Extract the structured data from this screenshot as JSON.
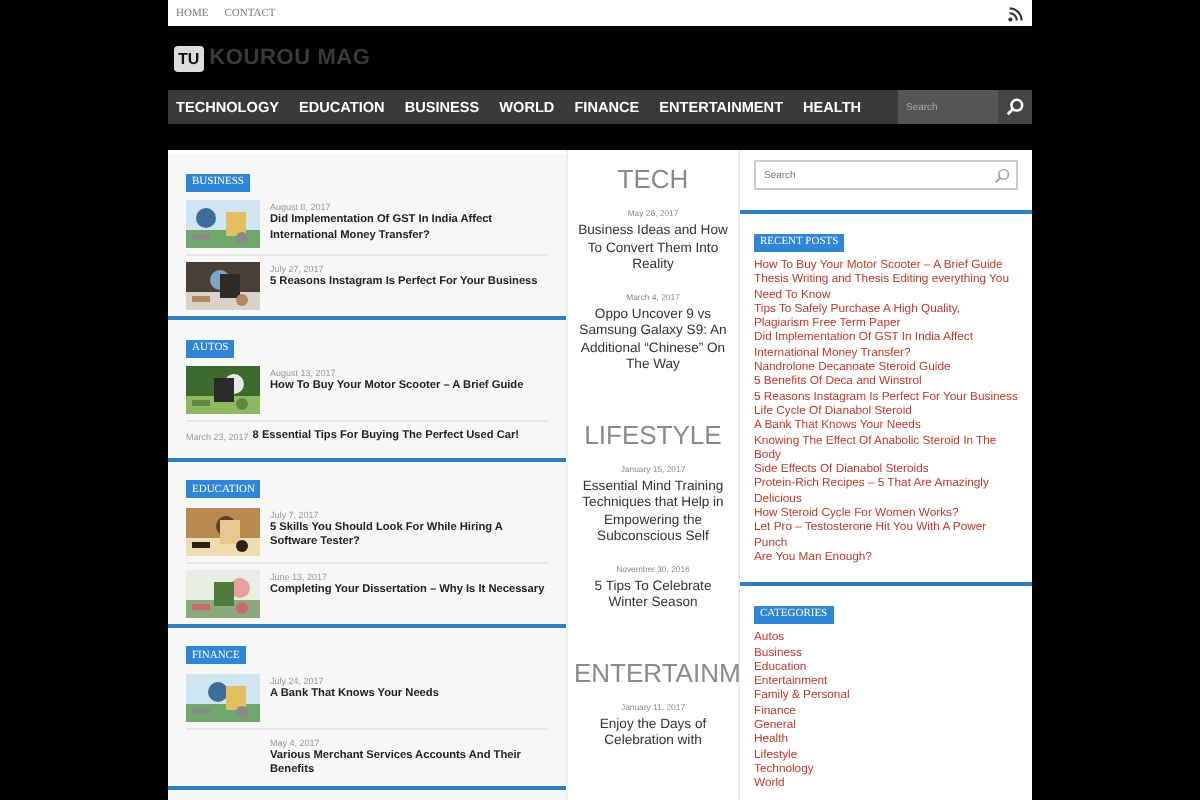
{
  "top_bar": {
    "links": [
      "HOME",
      "CONTACT"
    ]
  },
  "logo": {
    "badge": "TU",
    "name": "KOUROU MAG"
  },
  "nav": {
    "items": [
      "TECHNOLOGY",
      "EDUCATION",
      "BUSINESS",
      "WORLD",
      "FINANCE",
      "ENTERTAINMENT",
      "HEALTH"
    ],
    "search": {
      "placeholder": "Search"
    }
  },
  "left_sections": [
    {
      "label": "BUSINESS",
      "posts": [
        {
          "kind": "standard",
          "has_thumbnail": true,
          "date": "August 8, 2017",
          "title": "Did Implementation Of GST In India Affect International Money Transfer?"
        },
        {
          "kind": "standard",
          "has_thumbnail": true,
          "date": "July 27, 2017",
          "title": "5 Reasons Instagram Is Perfect For Your Business"
        }
      ]
    },
    {
      "label": "AUTOS",
      "posts": [
        {
          "kind": "standard",
          "has_thumbnail": true,
          "date": "August 13, 2017",
          "title": "How To Buy Your Motor Scooter – A Brief Guide"
        },
        {
          "kind": "inline",
          "has_thumbnail": false,
          "date": "March 23, 2017",
          "title": "8 Essential Tips For Buying The Perfect Used Car!"
        }
      ]
    },
    {
      "label": "EDUCATION",
      "posts": [
        {
          "kind": "standard",
          "has_thumbnail": true,
          "date": "July 7, 2017",
          "title": "5 Skills You Should Look For While Hiring A Software Tester?"
        },
        {
          "kind": "standard",
          "has_thumbnail": true,
          "date": "June 13, 2017",
          "title": "Completing Your Dissertation – Why Is It Necessary"
        }
      ]
    },
    {
      "label": "FINANCE",
      "posts": [
        {
          "kind": "standard",
          "has_thumbnail": true,
          "date": "July 24, 2017",
          "title": "A Bank That Knows Your Needs"
        },
        {
          "kind": "standard",
          "has_thumbnail": false,
          "date": "May 4, 2017",
          "title": "Various Merchant Services Accounts And Their Benefits"
        }
      ]
    }
  ],
  "middle_sections": [
    {
      "heading": "TECH",
      "posts": [
        {
          "date": "May 26, 2017",
          "title": "Business Ideas and How To Convert Them Into Reality"
        },
        {
          "date": "March 4, 2017",
          "title": "Oppo Uncover 9 vs Samsung Galaxy S9: An Additional “Chinese” On The Way"
        }
      ]
    },
    {
      "heading": "LIFESTYLE",
      "posts": [
        {
          "date": "January 15, 2017",
          "title": "Essential Mind Training Techniques that Help in Empowering the Subconscious Self"
        },
        {
          "date": "November 30, 2016",
          "title": "5 Tips To Celebrate Winter Season"
        }
      ]
    },
    {
      "heading": "ENTERTAINM",
      "posts": [
        {
          "date": "January 11, 2017",
          "title": "Enjoy the Days of Celebration with"
        }
      ]
    }
  ],
  "sidebar": {
    "search": {
      "placeholder": "Search"
    },
    "widgets": [
      {
        "label": "RECENT POSTS",
        "links": [
          "How To Buy Your Motor Scooter – A Brief Guide",
          "Thesis Writing and Thesis Editing everything You Need To Know",
          "Tips To Safely Purchase A High Quality, Plagiarism Free Term Paper",
          "Did Implementation Of GST In India Affect International Money Transfer?",
          "Nandrolone Decanoate Steroid Guide",
          "5 Benefits Of Deca and Winstrol",
          "5 Reasons Instagram Is Perfect For Your Business",
          "Life Cycle Of Dianabol Steroid",
          "A Bank That Knows Your Needs",
          "Knowing The Effect Of Anabolic Steroid In The Body",
          "Side Effects Of Dianabol Steroids",
          "Protein-Rich Recipes – 5 That Are Amazingly Delicious",
          "How Steroid Cycle For Women Works?",
          "Let Pro – Testosterone Hit You With A Power Punch",
          "Are You Man Enough?"
        ]
      },
      {
        "label": "CATEGORIES",
        "links": [
          "Autos",
          "Business",
          "Education",
          "Entertainment",
          "Family & Personal",
          "Finance",
          "General",
          "Health",
          "Lifestyle",
          "Technology",
          "World"
        ]
      }
    ]
  }
}
